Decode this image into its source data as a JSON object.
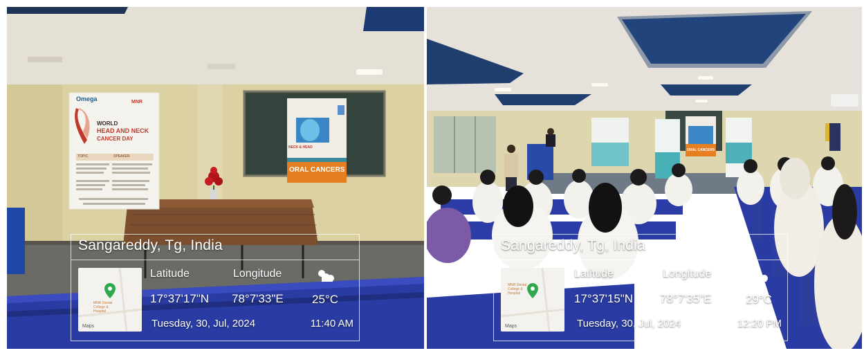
{
  "photos": [
    {
      "banner": {
        "brand_left": "Omega",
        "brand_right": "MNR",
        "title_line1": "WORLD",
        "title_line2": "HEAD AND NECK",
        "title_line3": "CANCER DAY",
        "col_topic": "TOPIC",
        "col_speaker": "SPEAKER"
      },
      "standee": {
        "bottom_line1": "NECK & HEAD",
        "bottom_line2": "ORAL CANCERS"
      },
      "gps": {
        "place": "Sangareddy, Tg, India",
        "latitude_label": "Latitude",
        "longitude_label": "Longitude",
        "latitude": "17°37'17\"N",
        "longitude": "78°7'33\"E",
        "temperature": "25°C",
        "date": "Tuesday, 30, Jul, 2024",
        "time": "11:40 AM",
        "map_label": "Maps",
        "map_place": "MNR Dental College & Hospital",
        "weather_icon": "cloudy-icon"
      }
    },
    {
      "gps": {
        "place": "Sangareddy, Tg, India",
        "latitude_label": "Latitude",
        "longitude_label": "Longitude",
        "latitude": "17°37'15\"N",
        "longitude": "78°7'35\"E",
        "temperature": "29°C",
        "date": "Tuesday, 30, Jul, 2024",
        "time": "12:20 PM",
        "map_label": "Maps",
        "map_place": "MNR Dental College & Hospital",
        "weather_icon": "cloudy-icon"
      },
      "standee": {
        "bottom_line": "ORAL CANCERS"
      }
    }
  ],
  "colors": {
    "wall": "#ddd2a6",
    "ceiling": "#e3ddd2",
    "bench_blue": "#2b3fa8",
    "ceiling_panel": "#1e3f7a",
    "banner_red": "#c0392b",
    "banner_orange": "#e67e22"
  }
}
